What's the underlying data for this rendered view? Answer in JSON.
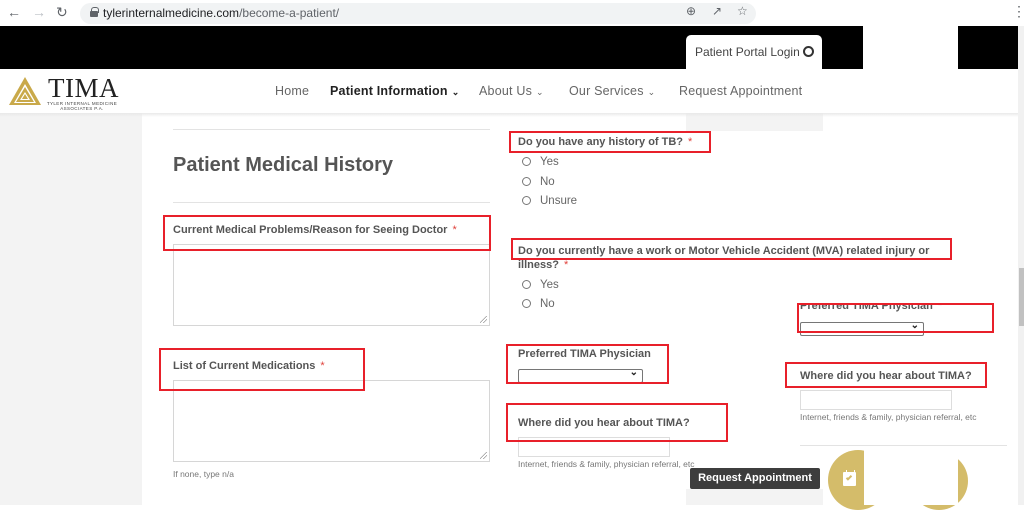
{
  "browser": {
    "url_host": "tylerinternalmedicine.com",
    "url_path": "/become-a-patient/",
    "icons": [
      "back-icon",
      "forward-icon",
      "reload-icon",
      "lock-icon",
      "zoom-icon",
      "share-icon",
      "star-icon",
      "menu-icon"
    ]
  },
  "topbar": {
    "portal_label": "Patient Portal Login",
    "portal_icon": "user-circle-icon"
  },
  "logo": {
    "name": "TIMA",
    "sub_line1": "TYLER INTERNAL MEDICINE",
    "sub_line2": "ASSOCIATES P.A."
  },
  "nav": {
    "items": [
      {
        "label": "Home",
        "dropdown": false,
        "active": false
      },
      {
        "label": "Patient Information",
        "dropdown": true,
        "active": true
      },
      {
        "label": "About Us",
        "dropdown": true,
        "active": false
      },
      {
        "label": "Our Services",
        "dropdown": true,
        "active": false
      },
      {
        "label": "Request Appointment",
        "dropdown": false,
        "active": false
      }
    ]
  },
  "form": {
    "section_title": "Patient Medical History",
    "medical_problems": {
      "label": "Current Medical Problems/Reason for Seeing Doctor",
      "required": "*",
      "value": ""
    },
    "medications": {
      "label": "List of Current Medications",
      "required": "*",
      "value": "",
      "help": "If none, type n/a"
    },
    "tb_history": {
      "label": "Do you have any history of TB?",
      "required": "*",
      "options": [
        "Yes",
        "No",
        "Unsure"
      ],
      "selected": null
    },
    "mva": {
      "label_line1": "Do you currently have a work or Motor Vehicle Accident (MVA) related injury or",
      "label_line2": "illness?",
      "required": "*",
      "options": [
        "Yes",
        "No"
      ],
      "selected": null
    },
    "physician": {
      "label": "Preferred TIMA Physician",
      "required": "*",
      "selected": ""
    },
    "hear_about": {
      "label": "Where did you hear about TIMA?",
      "value": "",
      "help": "Internet, friends & family, physician referral, etc"
    }
  },
  "ghost": {
    "physician_label": "Preferred TIMA Physician",
    "physician_required": "*",
    "hear_label": "Where did you hear about TIMA?",
    "hear_help": "Internet, friends & family, physician referral, etc"
  },
  "floating": {
    "request_label": "Request Appointment"
  },
  "colors": {
    "highlight_box": "#e8202a",
    "required": "#e0413b",
    "gold": "#d4bc6a"
  }
}
